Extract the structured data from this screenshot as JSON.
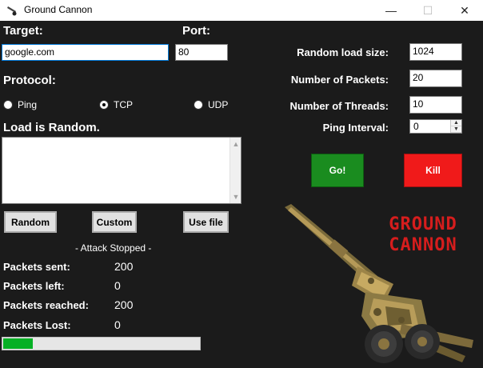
{
  "window": {
    "title": "Ground Cannon",
    "minimize_glyph": "—",
    "maximize_glyph": "☐",
    "close_glyph": "✕"
  },
  "target": {
    "label": "Target:",
    "value": "google.com"
  },
  "port": {
    "label": "Port:",
    "value": "80"
  },
  "protocol": {
    "label": "Protocol:",
    "options": [
      {
        "label": "Ping",
        "checked": false
      },
      {
        "label": "TCP",
        "checked": true
      },
      {
        "label": "UDP",
        "checked": false
      }
    ]
  },
  "load": {
    "status_text": "Load is Random.",
    "content": ""
  },
  "load_buttons": {
    "random": "Random",
    "custom": "Custom",
    "use_file": "Use file"
  },
  "attack_status": "- Attack Stopped -",
  "stats": [
    {
      "label": "Packets sent:",
      "value": "200"
    },
    {
      "label": "Packets left:",
      "value": "0"
    },
    {
      "label": "Packets reached:",
      "value": "200"
    },
    {
      "label": "Packets Lost:",
      "value": "0"
    }
  ],
  "progress": {
    "fraction": 0.15,
    "color": "#06b025"
  },
  "settings": {
    "random_load_size": {
      "label": "Random load size:",
      "value": "1024"
    },
    "num_packets": {
      "label": "Number of Packets:",
      "value": "20"
    },
    "num_threads": {
      "label": "Number of Threads:",
      "value": "10"
    },
    "ping_interval": {
      "label": "Ping Interval:",
      "value": "0"
    }
  },
  "actions": {
    "go": "Go!",
    "kill": "Kill"
  },
  "logo": {
    "line1": "GROUND",
    "line2": "CANNON",
    "color": "#d61d1d"
  },
  "icons": [
    "cannon-icon",
    "minimize-icon",
    "maximize-icon",
    "close-icon",
    "scroll-up-icon",
    "scroll-down-icon",
    "spin-up-icon",
    "spin-down-icon"
  ]
}
